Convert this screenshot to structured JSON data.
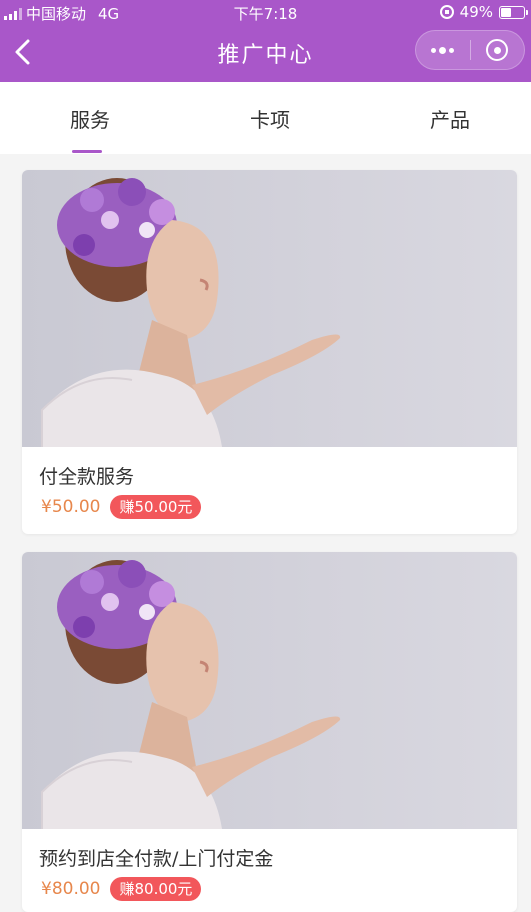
{
  "status_bar": {
    "carrier": "中国移动",
    "network": "4G",
    "time": "下午7:18",
    "battery": "49%",
    "battery_level": 0.49
  },
  "nav": {
    "title": "推广中心"
  },
  "tabs": [
    {
      "label": "服务",
      "active": true
    },
    {
      "label": "卡项",
      "active": false
    },
    {
      "label": "产品",
      "active": false
    }
  ],
  "items": [
    {
      "title": "付全款服务",
      "price": "¥50.00",
      "earn": "赚50.00元"
    },
    {
      "title": "预约到店全付款/上门付定金",
      "price": "¥80.00",
      "earn": "赚80.00元"
    }
  ],
  "colors": {
    "brand": "#a957c9",
    "price": "#e7874c",
    "earn_badge": "#f2575b"
  }
}
